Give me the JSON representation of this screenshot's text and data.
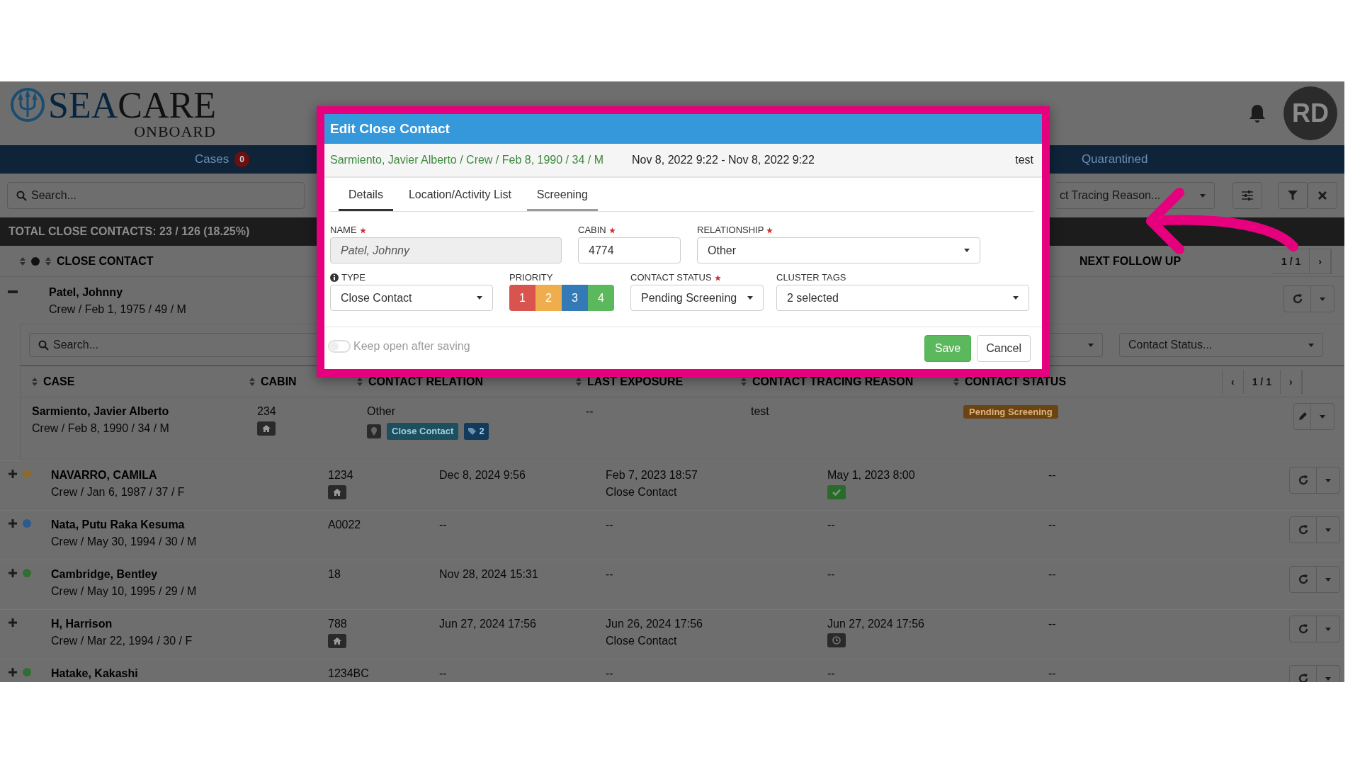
{
  "header": {
    "logo": {
      "sea": "SEA",
      "care": "CARE",
      "sub": "ONBOARD"
    },
    "avatar": "RD"
  },
  "nav": [
    {
      "label": "Cases",
      "count": "0"
    },
    {
      "label": "Quarantined"
    }
  ],
  "filters": {
    "search_placeholder": "Search...",
    "reason_placeholder": "ct Tracing Reason..."
  },
  "total": "TOTAL CLOSE CONTACTS: 23 / 126 (18.25%)",
  "outer_header": {
    "close_contact": "CLOSE CONTACT",
    "next_follow_up": "NEXT FOLLOW UP",
    "pager": "1 / 1",
    "pager_next": "›"
  },
  "expanded_row": {
    "name": "Patel, Johnny",
    "details": "Crew / Feb 1, 1975 / 49 / M",
    "expanded": true
  },
  "nested": {
    "search_placeholder": "Search...",
    "status_placeholder": "Contact Status...",
    "columns": [
      "CASE",
      "CABIN",
      "CONTACT RELATION",
      "LAST EXPOSURE",
      "CONTACT TRACING REASON",
      "CONTACT STATUS"
    ],
    "pager_prev": "‹",
    "pager": "1 / 1",
    "pager_next": "›",
    "row": {
      "name": "Sarmiento, Javier Alberto",
      "details": "Crew / Feb 8, 1990 / 34 / M",
      "cabin": "234",
      "home": true,
      "relation": "Other",
      "type_badge": "Close Contact",
      "tag_count": "2",
      "last_exposure": "--",
      "reason": "test",
      "status": "Pending Screening"
    }
  },
  "rows": [
    {
      "name": "NAVARRO, CAMILA",
      "details": "Crew / Jan 6, 1987 / 37 / F",
      "expanded": false,
      "color": "#8b6a30",
      "cabin": "1234",
      "home": true,
      "column_3": "Dec 8, 2024 9:56",
      "column_4": "Feb 7, 2023 18:57",
      "column_4_sub": "Close Contact",
      "column_5": "May 1, 2023 8:00",
      "column_5_badge": {
        "kind": "check"
      },
      "column_6": "--"
    },
    {
      "name": "Nata, Putu Raka Kesuma",
      "details": "Crew / May 30, 1994 / 30 / M",
      "expanded": false,
      "color": "#2d5b8c",
      "cabin": "A0022",
      "home": false,
      "column_3": "--",
      "column_4": "--",
      "column_5": "--",
      "column_6": "--"
    },
    {
      "name": "Cambridge, Bentley",
      "details": "Crew / May 10, 1995 / 29 / M",
      "expanded": false,
      "color": "#2f6f2f",
      "cabin": "18",
      "home": false,
      "column_3": "Nov 28, 2024 15:31",
      "column_4": "--",
      "column_5": "--",
      "column_6": "--"
    },
    {
      "name": "H, Harrison",
      "details": "Crew / Mar 22, 1994 / 30 / F",
      "expanded": false,
      "cabin": "788",
      "home": true,
      "column_3": "Jun 27, 2024 17:56",
      "column_4": "Jun 26, 2024 17:56",
      "column_4_sub": "Close Contact",
      "column_5": "Jun 27, 2024 17:56",
      "column_5_badge": {
        "kind": "clock"
      },
      "column_6": "--"
    },
    {
      "name": "Hatake, Kakashi",
      "expanded": false,
      "color": "#2f6f2f",
      "cabin": "1234BC",
      "home": false,
      "column_3": "--",
      "column_4": "--",
      "column_5": "--",
      "column_6": "--"
    }
  ],
  "modal": {
    "title": "Edit Close Contact",
    "person": "Sarmiento, Javier Alberto / Crew / Feb 8, 1990 / 34 / M",
    "period": "Nov 8, 2022 9:22 - Nov 8, 2022 9:22",
    "note": "test",
    "tabs": [
      {
        "label": "Details",
        "selected": true,
        "hovered": false
      },
      {
        "label": "Location/Activity List",
        "selected": false,
        "hovered": false
      },
      {
        "label": "Screening",
        "selected": false,
        "hovered": true
      }
    ],
    "name": {
      "label": "NAME",
      "required": true,
      "value": "Patel, Johnny"
    },
    "cabin": {
      "label": "CABIN",
      "required": true,
      "value": "4774"
    },
    "relationship": {
      "label": "RELATIONSHIP",
      "required": true,
      "value": "Other"
    },
    "type": {
      "label": "TYPE",
      "value": "Close Contact"
    },
    "priority": {
      "label": "PRIORITY",
      "options": [
        {
          "label": "1",
          "color": "#d9534f"
        },
        {
          "label": "2",
          "color": "#f0ad4e"
        },
        {
          "label": "3",
          "color": "#337ab7"
        },
        {
          "label": "4",
          "color": "#5cb85c"
        }
      ]
    },
    "contact_status": {
      "label": "CONTACT STATUS",
      "required": true,
      "value": "Pending Screening"
    },
    "cluster_tags": {
      "label": "CLUSTER TAGS",
      "value": "2 selected"
    },
    "keep_open": {
      "label": "Keep open after saving",
      "on": false
    },
    "buttons": [
      {
        "label": "Save",
        "kind": "primary"
      },
      {
        "label": "Cancel",
        "kind": "default"
      }
    ]
  }
}
